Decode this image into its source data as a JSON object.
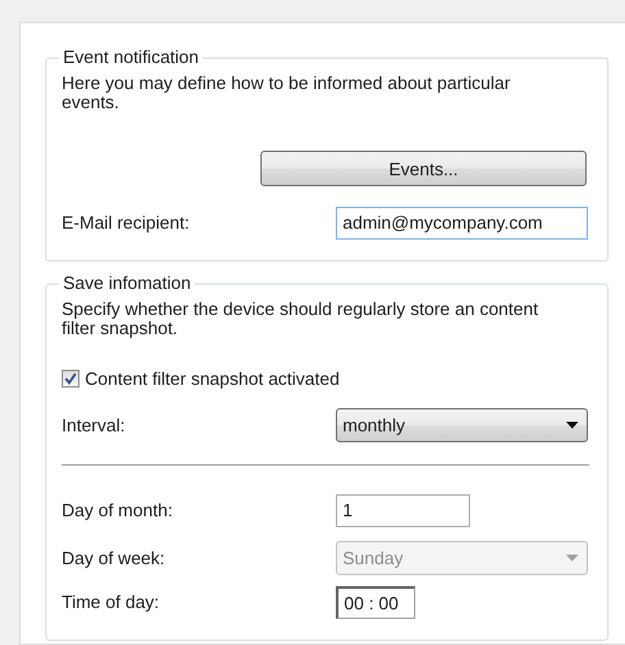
{
  "event_notification": {
    "legend": "Event notification",
    "description": "Here you may define how to be informed about particular events.",
    "events_button": "Events...",
    "email": {
      "label": "E-Mail recipient:",
      "value": "admin@mycompany.com"
    }
  },
  "save_information": {
    "legend": "Save infomation",
    "description": "Specify whether the device should regularly store an content filter snapshot.",
    "snapshot": {
      "label": "Content filter snapshot activated",
      "checked": true
    },
    "interval": {
      "label": "Interval:",
      "value": "monthly",
      "disabled": false
    },
    "fields": [
      {
        "kind": "text",
        "label": "Day of month:",
        "value": "1",
        "disabled": false
      },
      {
        "kind": "select",
        "label": "Day of week:",
        "value": "Sunday",
        "disabled": true
      },
      {
        "kind": "time",
        "label": "Time of day:",
        "value": "00 : 00",
        "disabled": false
      }
    ]
  }
}
